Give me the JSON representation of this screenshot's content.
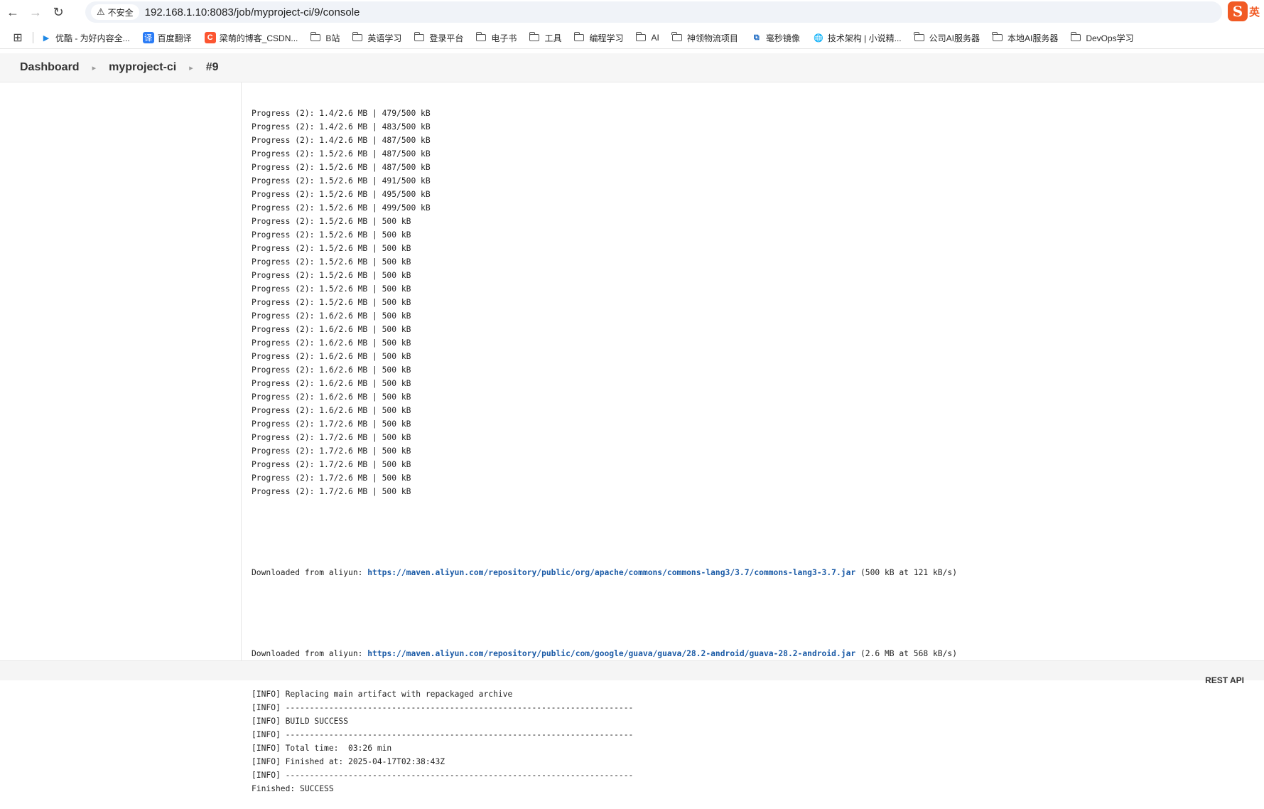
{
  "browser": {
    "security_label": "不安全",
    "url": "192.168.1.10:8083/job/myproject-ci/9/console",
    "ime_label": "英",
    "ime_logo": "S"
  },
  "bookmarks": [
    {
      "label": "优酷 - 为好内容全...",
      "icon": "youku-icon"
    },
    {
      "label": "百度翻译",
      "icon": "baidu-translate-icon"
    },
    {
      "label": "梁萌的博客_CSDN...",
      "icon": "csdn-icon"
    },
    {
      "label": "B站",
      "icon": "folder-icon"
    },
    {
      "label": "英语学习",
      "icon": "folder-icon"
    },
    {
      "label": "登录平台",
      "icon": "folder-icon"
    },
    {
      "label": "电子书",
      "icon": "folder-icon"
    },
    {
      "label": "工具",
      "icon": "folder-icon"
    },
    {
      "label": "编程学习",
      "icon": "folder-icon"
    },
    {
      "label": "AI",
      "icon": "folder-icon"
    },
    {
      "label": "神领物流项目",
      "icon": "folder-icon"
    },
    {
      "label": "毫秒镜像",
      "icon": "mirror-icon"
    },
    {
      "label": "技术架构 | 小说精...",
      "icon": "globe-icon"
    },
    {
      "label": "公司AI服务器",
      "icon": "folder-icon"
    },
    {
      "label": "本地AI服务器",
      "icon": "folder-icon"
    },
    {
      "label": "DevOps学习",
      "icon": "folder-icon"
    }
  ],
  "breadcrumb": {
    "dashboard": "Dashboard",
    "job": "myproject-ci",
    "build": "#9"
  },
  "console": {
    "lines": [
      "Progress (2): 1.4/2.6 MB | 479/500 kB",
      "Progress (2): 1.4/2.6 MB | 483/500 kB",
      "Progress (2): 1.4/2.6 MB | 487/500 kB",
      "Progress (2): 1.5/2.6 MB | 487/500 kB",
      "Progress (2): 1.5/2.6 MB | 487/500 kB",
      "Progress (2): 1.5/2.6 MB | 491/500 kB",
      "Progress (2): 1.5/2.6 MB | 495/500 kB",
      "Progress (2): 1.5/2.6 MB | 499/500 kB",
      "Progress (2): 1.5/2.6 MB | 500 kB",
      "Progress (2): 1.5/2.6 MB | 500 kB",
      "Progress (2): 1.5/2.6 MB | 500 kB",
      "Progress (2): 1.5/2.6 MB | 500 kB",
      "Progress (2): 1.5/2.6 MB | 500 kB",
      "Progress (2): 1.5/2.6 MB | 500 kB",
      "Progress (2): 1.5/2.6 MB | 500 kB",
      "Progress (2): 1.6/2.6 MB | 500 kB",
      "Progress (2): 1.6/2.6 MB | 500 kB",
      "Progress (2): 1.6/2.6 MB | 500 kB",
      "Progress (2): 1.6/2.6 MB | 500 kB",
      "Progress (2): 1.6/2.6 MB | 500 kB",
      "Progress (2): 1.6/2.6 MB | 500 kB",
      "Progress (2): 1.6/2.6 MB | 500 kB",
      "Progress (2): 1.6/2.6 MB | 500 kB",
      "Progress (2): 1.7/2.6 MB | 500 kB",
      "Progress (2): 1.7/2.6 MB | 500 kB",
      "Progress (2): 1.7/2.6 MB | 500 kB",
      "Progress (2): 1.7/2.6 MB | 500 kB",
      "Progress (2): 1.7/2.6 MB | 500 kB",
      "Progress (2): 1.7/2.6 MB | 500 kB"
    ],
    "download1": {
      "prefix": "Downloaded from aliyun: ",
      "link": "https://maven.aliyun.com/repository/public/org/apache/commons/commons-lang3/3.7/commons-lang3-3.7.jar",
      "suffix": " (500 kB at 121 kB/s)"
    },
    "download2": {
      "prefix": "Downloaded from aliyun: ",
      "link": "https://maven.aliyun.com/repository/public/com/google/guava/guava/28.2-android/guava-28.2-android.jar",
      "suffix": " (2.6 MB at 568 kB/s)"
    },
    "tail": [
      "[INFO] Replacing main artifact with repackaged archive",
      "[INFO] ------------------------------------------------------------------------",
      "[INFO] BUILD SUCCESS",
      "[INFO] ------------------------------------------------------------------------",
      "[INFO] Total time:  03:26 min",
      "[INFO] Finished at: 2025-04-17T02:38:43Z",
      "[INFO] ------------------------------------------------------------------------",
      "Finished: SUCCESS"
    ]
  },
  "footer": {
    "rest_api": "REST API"
  }
}
